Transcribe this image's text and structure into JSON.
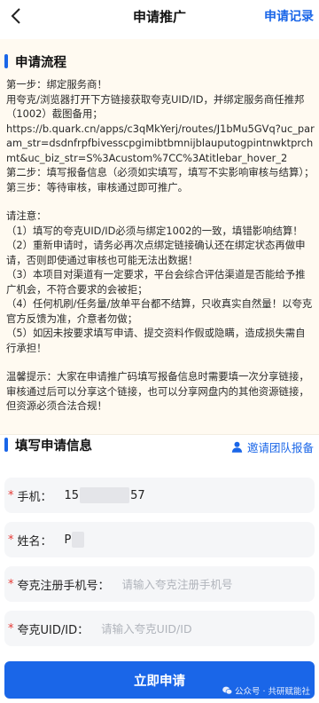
{
  "navbar": {
    "title": "申请推广",
    "record_label": "申请记录",
    "back_icon": "chevron-left-icon"
  },
  "flow_section": {
    "title": "申请流程",
    "paragraphs": [
      "第一步：绑定服务商！",
      "用夸克/浏览器打开下方链接获取夸克UID/ID，并绑定服务商任推邦（1002）截图备用；",
      "https://b.quark.cn/apps/c3qMkYerj/routes/J1bMu5GVq?uc_param_str=dsdnfrpfbivesscpgimibtbmnijblauputogpintnwktprchmt&uc_biz_str=S%3Acustom%7CC%3Atitlebar_hover_2",
      "第二步：填写报备信息（必须如实填写，填写不实影响审核与结算）；",
      "第三步：等待审核，审核通过即可推广。",
      "",
      "请注意：",
      "（1）填写的夸克UID/ID必须与绑定1002的一致，填错影响结算！",
      "（2）重新申请时，请务必再次点绑定链接确认还在绑定状态再做申请，否则即使通过审核也可能无法出数据！",
      "（3）本项目对渠道有一定要求，平台会综合评估渠道是否能给予推广机会，不符合要求的会被拒；",
      "（4）任何机刷/任务量/放单平台都不结算，只收真实自然量！以夸克官方反馈为准，介意者勿做；",
      "（5）如因未按要求填写申请、提交资料作假或隐瞒，造成损失需自行承担！",
      "",
      "温馨提示：大家在申请推广码填写报备信息时需要填一次分享链接，审核通过后可以分享这个链接，也可以分享网盘内的其他资源链接，但资源必须合法合规！"
    ]
  },
  "form_section": {
    "title": "填写申请信息",
    "invite_label": "邀请团队报备",
    "invite_icon": "user-icon",
    "fields": [
      {
        "label": "手机：",
        "value_prefix": "15",
        "value_suffix": "57",
        "required": "*"
      },
      {
        "label": "姓名：",
        "value_prefix": "P",
        "required": "*"
      },
      {
        "label": "夸克注册手机号：",
        "placeholder": "请输入夸克注册手机号",
        "required": "*"
      },
      {
        "label": "夸克UID/ID：",
        "placeholder": "请输入夸克UID/ID",
        "required": "*"
      }
    ]
  },
  "submit_label": "立即申请",
  "watermark": {
    "text": "公众号 · 共研赋能社",
    "icon": "wechat-icon"
  },
  "colors": {
    "accent": "#1a66e8",
    "required": "#e53935",
    "card_background": "#fffaf1",
    "field_background": "#f5f6f8"
  }
}
